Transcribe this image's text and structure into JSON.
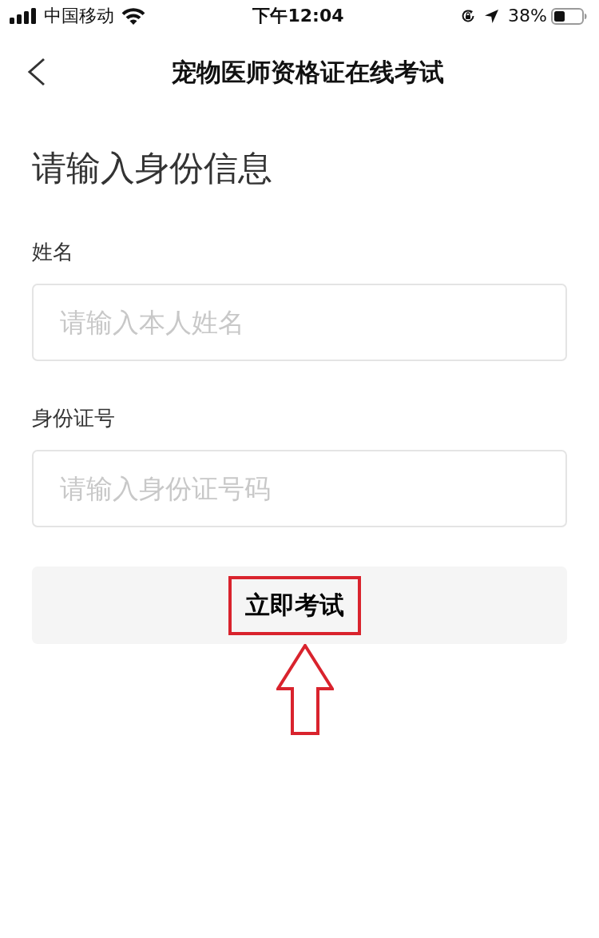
{
  "status_bar": {
    "carrier": "中国移动",
    "time": "下午12:04",
    "battery": "38%"
  },
  "nav": {
    "title": "宠物医师资格证在线考试"
  },
  "heading": "请输入身份信息",
  "fields": [
    {
      "label": "姓名",
      "placeholder": "请输入本人姓名"
    },
    {
      "label": "身份证号",
      "placeholder": "请输入身份证号码"
    }
  ],
  "submit": {
    "label": "立即考试",
    "highlighted": true
  },
  "annotations": [
    {
      "kind": "arrow"
    }
  ]
}
